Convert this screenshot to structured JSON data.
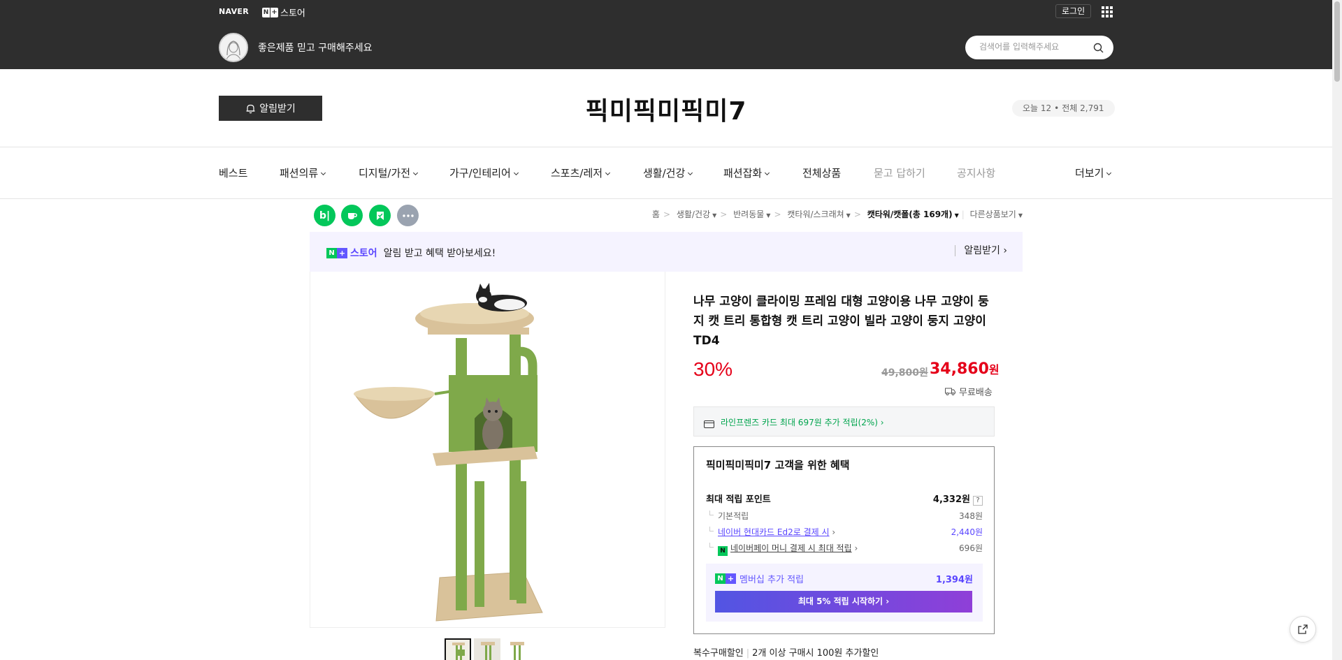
{
  "top": {
    "naver": "NAVER",
    "store_label": "스토어",
    "login": "로그인",
    "slogan": "좋은제품 믿고 구매해주세요",
    "search_placeholder": "검색어를 입력해주세요"
  },
  "store": {
    "alert_button": "알림받기",
    "title": "픽미픽미픽미7",
    "today": "오늘 12",
    "total": "전체 2,791"
  },
  "nav": [
    {
      "label": "베스트"
    },
    {
      "label": "패션의류"
    },
    {
      "label": "디지털/가전"
    },
    {
      "label": "가구/인테리어"
    },
    {
      "label": "스포츠/레저"
    },
    {
      "label": "생활/건강"
    },
    {
      "label": "패션잡화"
    },
    {
      "label": "전체상품"
    },
    {
      "label": "묻고 답하기"
    },
    {
      "label": "공지사항"
    },
    {
      "label": "더보기"
    }
  ],
  "breadcrumb": {
    "home": "홈",
    "c1": "생활/건강",
    "c2": "반려동물",
    "c3": "캣타워/스크래쳐",
    "c4": "캣타워/캣폴(총 169개)",
    "more": "다른상품보기"
  },
  "promo": {
    "store": "스토어",
    "text": "알림 받고 혜택 받아보세요!",
    "button": "알림받기"
  },
  "product": {
    "title": "나무 고양이 클라이밍 프레임 대형 고양이용 나무 고양이 둥지 캣 트리 통합형 캣 트리 고양이 빌라 고양이 둥지 고양이 TD4",
    "discount": "30%",
    "original_price": "49,800원",
    "price_num": "34,860",
    "price_unit": "원",
    "delivery": "무료배송",
    "card_offer": "라인프렌즈 카드 최대 697원 추가 적립(2%)"
  },
  "benefit": {
    "title": "픽미픽미픽미7 고객을 위한 혜택",
    "max_label": "최대 적립 포인트",
    "max_value": "4,332원",
    "help": "?",
    "rows": [
      {
        "label": "기본적립",
        "value": "348원"
      },
      {
        "label": "네이버 현대카드 Ed2로 결제 시",
        "value": "2,440원"
      },
      {
        "label": "네이버페이 머니 결제 시 최대 적립",
        "value": "696원"
      }
    ],
    "member_label": "멤버십 추가 적립",
    "member_value": "1,394원",
    "member_button": "최대 5% 적립 시작하기"
  },
  "multi": {
    "label": "복수구매할인",
    "text": "2개 이상 구매시 100원 추가할인"
  },
  "colors": {
    "dark": "#2e2e2e",
    "red": "#e50019",
    "green": "#03c75a",
    "purple": "#5a46ff"
  }
}
